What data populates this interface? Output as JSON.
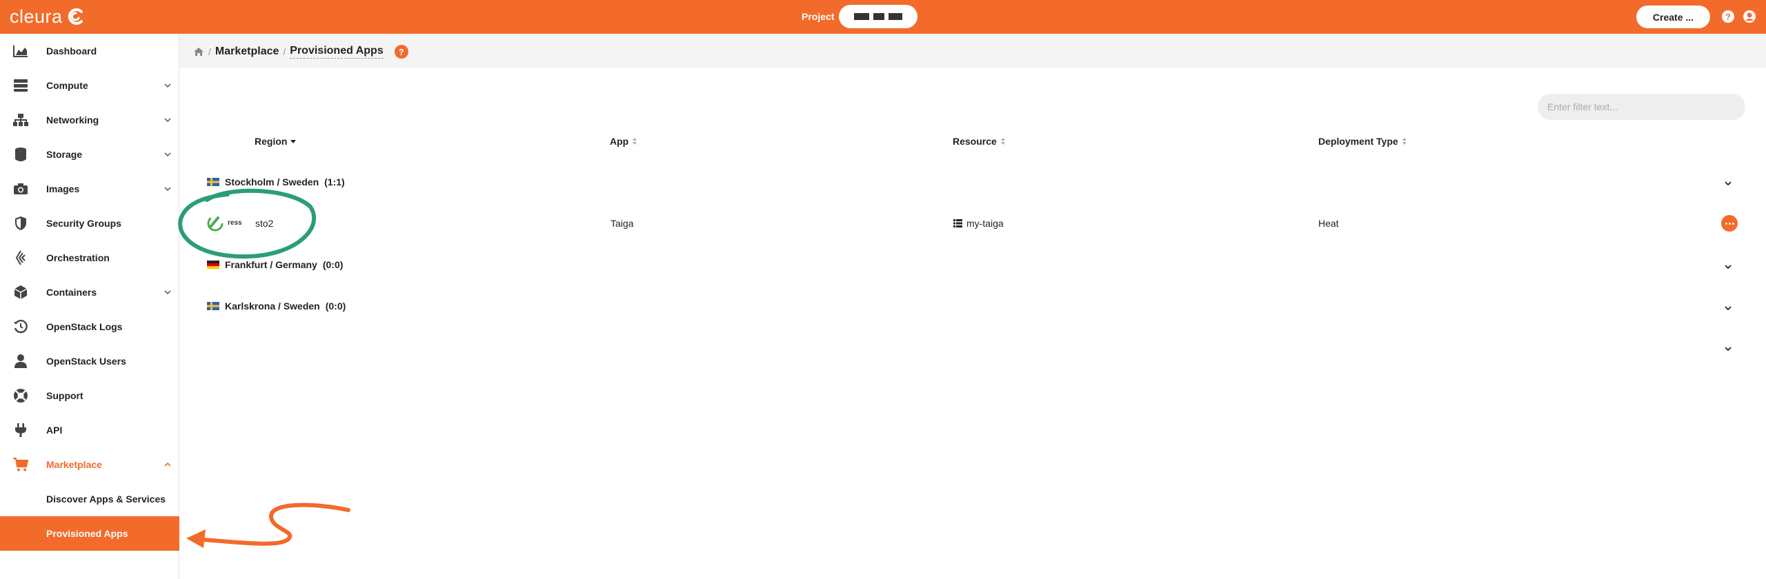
{
  "topbar": {
    "logo_text": "cleura",
    "project_label": "Project",
    "create_label": "Create ..."
  },
  "sidebar": {
    "items": [
      {
        "label": "Dashboard",
        "icon": "chart-area-icon",
        "expandable": false
      },
      {
        "label": "Compute",
        "icon": "server-icon",
        "expandable": true
      },
      {
        "label": "Networking",
        "icon": "sitemap-icon",
        "expandable": true
      },
      {
        "label": "Storage",
        "icon": "database-icon",
        "expandable": true
      },
      {
        "label": "Images",
        "icon": "camera-icon",
        "expandable": true
      },
      {
        "label": "Security Groups",
        "icon": "shield-icon",
        "expandable": false
      },
      {
        "label": "Orchestration",
        "icon": "layers-icon",
        "expandable": false
      },
      {
        "label": "Containers",
        "icon": "cube-icon",
        "expandable": true
      },
      {
        "label": "OpenStack Logs",
        "icon": "history-icon",
        "expandable": false
      },
      {
        "label": "OpenStack Users",
        "icon": "user-icon",
        "expandable": false
      },
      {
        "label": "Support",
        "icon": "lifebuoy-icon",
        "expandable": false
      },
      {
        "label": "API",
        "icon": "plug-icon",
        "expandable": false
      },
      {
        "label": "Marketplace",
        "icon": "cart-icon",
        "expandable": true,
        "expanded": true
      },
      {
        "label": "Discover Apps & Services",
        "sub": true
      },
      {
        "label": "Provisioned Apps",
        "sub": true,
        "active": true
      }
    ]
  },
  "breadcrumb": {
    "items": [
      "Marketplace"
    ],
    "current": "Provisioned Apps"
  },
  "filter": {
    "placeholder": "Enter filter text..."
  },
  "table": {
    "columns": [
      "Region",
      "App",
      "Resource",
      "Deployment Type"
    ],
    "groups": [
      {
        "label": "Stockholm / Sweden",
        "count": "(1:1)",
        "flag": "se"
      },
      {
        "label": "Frankfurt / Germany",
        "count": "(0:0)",
        "flag": "de"
      },
      {
        "label": "Karlskrona / Sweden",
        "count": "(0:0)",
        "flag": "se"
      }
    ],
    "row": {
      "status": "ress",
      "region": "sto2",
      "app": "Taiga",
      "resource": "my-taiga",
      "deployment_type": "Heat"
    }
  },
  "colors": {
    "brand_orange": "#f26b2a",
    "annotation_green": "#2a9d7c"
  }
}
